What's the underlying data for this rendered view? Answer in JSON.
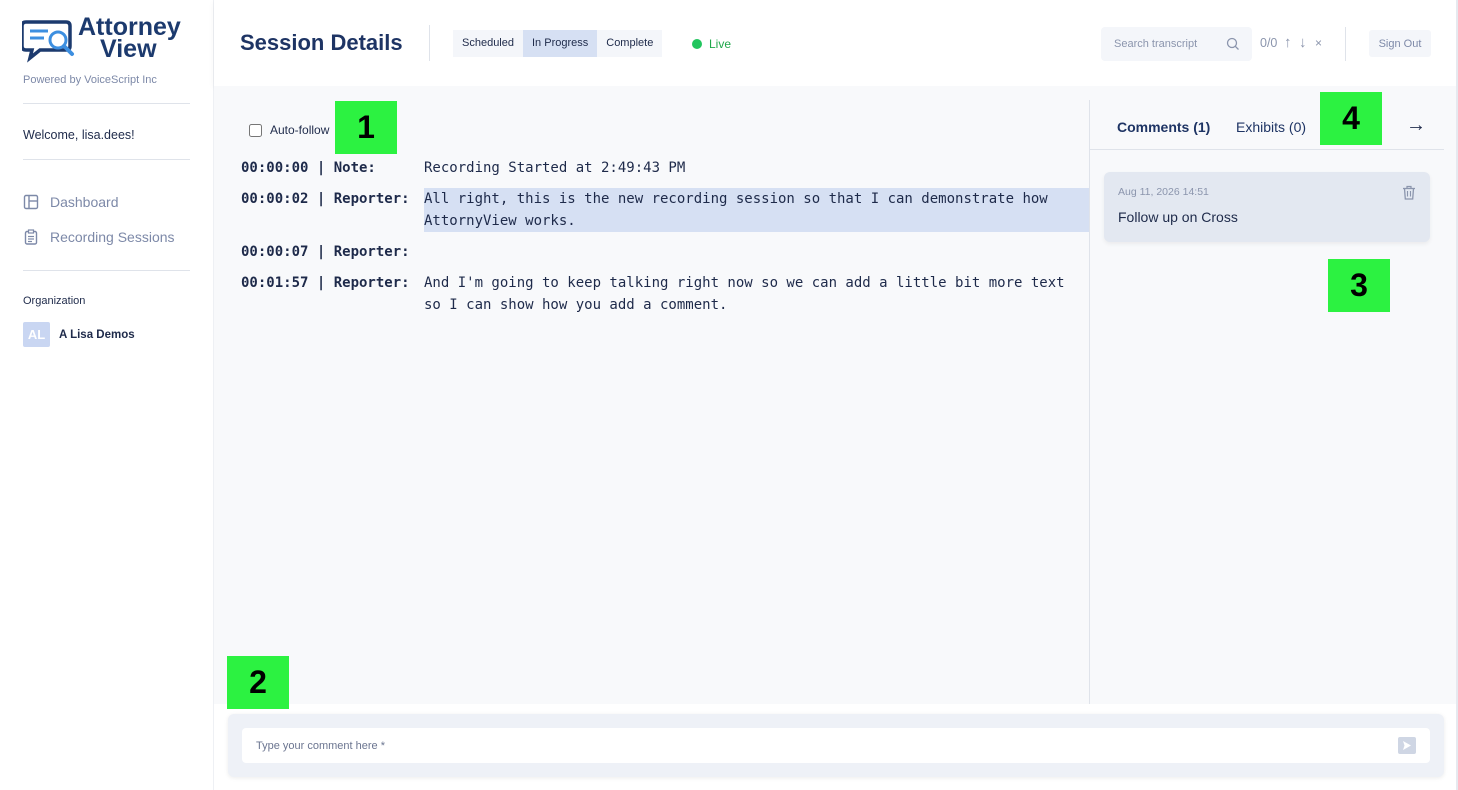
{
  "sidebar": {
    "logo_line1": "Attorney",
    "logo_line2": "View",
    "powered_by": "Powered by VoiceScript Inc",
    "welcome": "Welcome, lisa.dees!",
    "nav": [
      {
        "label": "Dashboard",
        "icon": "dashboard-icon"
      },
      {
        "label": "Recording Sessions",
        "icon": "clipboard-icon"
      }
    ],
    "org_label": "Organization",
    "org_initials": "AL",
    "org_name": "A Lisa Demos"
  },
  "header": {
    "title": "Session Details",
    "status_tabs": [
      "Scheduled",
      "In Progress",
      "Complete"
    ],
    "active_status": "In Progress",
    "live_label": "Live",
    "search_placeholder": "Search transcript",
    "match_count": "0/0",
    "up_arrow": "↑",
    "down_arrow": "↓",
    "close_label": "×",
    "sign_out": "Sign Out"
  },
  "transcript": {
    "auto_follow_label": "Auto-follow",
    "lines": [
      {
        "ts": "00:00:00 | Note:",
        "text": "Recording Started at 2:49:43 PM",
        "highlight": false
      },
      {
        "ts": "00:00:02 | Reporter:",
        "text": "All right, this is the new recording session so that I can demonstrate how AttornyView works.",
        "highlight": true
      },
      {
        "ts": "00:00:07 | Reporter:",
        "text": "",
        "highlight": false
      },
      {
        "ts": "00:01:57 | Reporter:",
        "text": "And I'm going to keep talking right now so we can add a little bit more text so I can show how you add a comment.",
        "highlight": false
      }
    ]
  },
  "right_panel": {
    "tab_comments": "Comments (1)",
    "tab_exhibits": "Exhibits (0)",
    "collapse_arrow": "→",
    "comments": [
      {
        "date": "Aug 11, 2026 14:51",
        "text": "Follow up on Cross"
      }
    ]
  },
  "comment_bar": {
    "placeholder": "Type your comment here *"
  },
  "tags": [
    "1",
    "2",
    "3",
    "4"
  ],
  "colors": {
    "accent": "#1e3464",
    "live": "#22c55e",
    "highlight": "#d6e0f3",
    "tag": "#2cf241"
  }
}
